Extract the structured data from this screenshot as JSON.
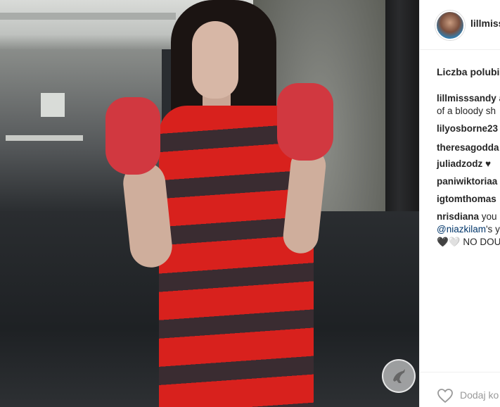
{
  "post": {
    "username": "lillmiss",
    "likes_label": "Liczba polubie",
    "comments": [
      {
        "user": "lillmisssandy",
        "text": " a",
        "continuation": "of a bloody sh"
      },
      {
        "user": "lilyosborne23",
        "text": ""
      },
      {
        "user": "theresagodda",
        "text": ""
      },
      {
        "user": "juliadzodz",
        "text": " ♥"
      },
      {
        "user": "paniwiktoriaa",
        "text": ""
      },
      {
        "user": "igtomthomas",
        "text": ""
      },
      {
        "user": "nrisdiana",
        "text": " you",
        "mention": "@niazkilam",
        "mention_after": "'s y",
        "line3": "🖤🤍 NO DOU"
      }
    ],
    "add_comment_placeholder": "Dodaj ko"
  },
  "icons": {
    "heart": "heart-outline-icon",
    "watermark": "kangaroo-watermark-icon"
  },
  "colors": {
    "username": "#262626",
    "mention": "#003569",
    "placeholder": "#999999",
    "divider": "#efefef"
  }
}
